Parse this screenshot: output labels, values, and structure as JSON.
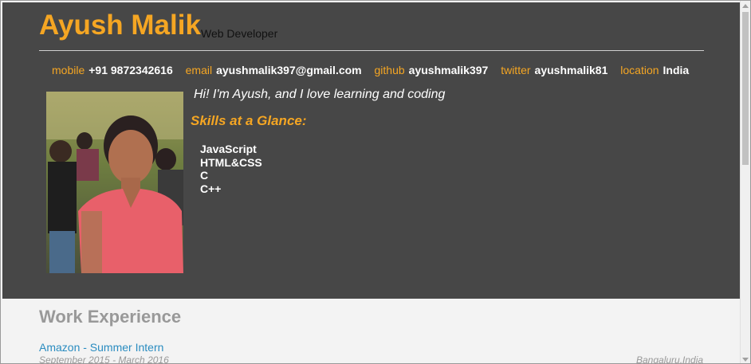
{
  "header": {
    "name": "Ayush Malik",
    "role": "Web Developer"
  },
  "contacts": [
    {
      "label": "mobile",
      "value": "+91 9872342616"
    },
    {
      "label": "email",
      "value": "ayushmalik397@gmail.com"
    },
    {
      "label": "github",
      "value": "ayushmalik397"
    },
    {
      "label": "twitter",
      "value": "ayushmalik81"
    },
    {
      "label": "location",
      "value": "India"
    }
  ],
  "intro": "Hi! I'm Ayush, and I love learning and coding",
  "skills": {
    "title": "Skills at a Glance:",
    "items": [
      "JavaScript",
      "HTML&CSS",
      "C",
      "C++"
    ]
  },
  "work": {
    "title": "Work Experience",
    "jobs": [
      {
        "title": "Amazon - Summer Intern",
        "dates": "September 2015 - March 2016",
        "location": "Bangaluru,India"
      }
    ]
  },
  "colors": {
    "accent": "#f5a623",
    "header_bg": "#474747",
    "link": "#2a8cc0",
    "muted": "#999999"
  },
  "icons": {
    "photo": "profile-photo"
  }
}
